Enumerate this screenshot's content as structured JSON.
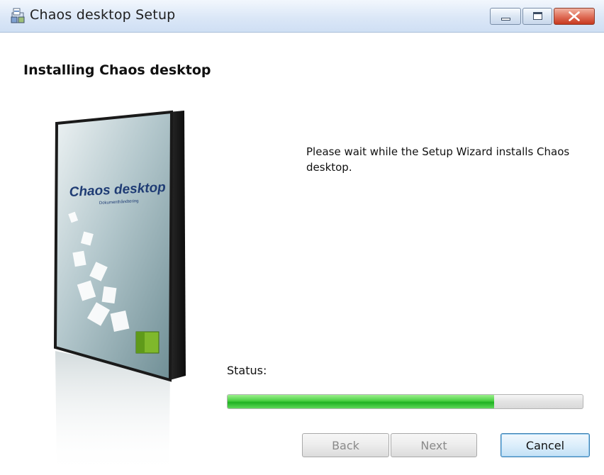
{
  "window": {
    "title": "Chaos desktop Setup",
    "controls": {
      "minimize": "minimize",
      "maximize": "maximize",
      "close": "close"
    }
  },
  "page": {
    "heading": "Installing Chaos desktop",
    "description": "Please wait while the Setup Wizard installs Chaos desktop."
  },
  "product_box": {
    "title": "Chaos desktop",
    "subtitle": "Dokumenthåndtering"
  },
  "status": {
    "label": "Status:",
    "progress_percent": 75
  },
  "buttons": {
    "back": "Back",
    "next": "Next",
    "cancel": "Cancel"
  },
  "colors": {
    "progress_green": "#2dbd2e",
    "titlebar": "#dbe7f7",
    "close_red": "#d9533a"
  }
}
